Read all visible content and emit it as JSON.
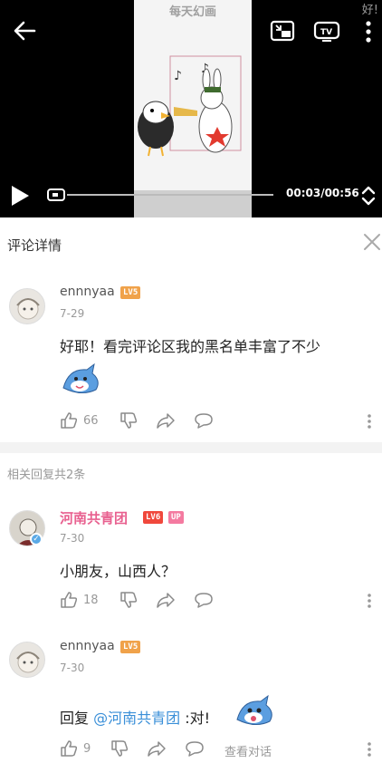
{
  "player": {
    "caption": "每天幻画",
    "corner_glyph": "好!",
    "time": "00:03/00:56",
    "progress": 0.05,
    "icons": [
      "back-arrow-icon",
      "picture-in-picture-icon",
      "cast-tv-icon",
      "more-vertical-icon",
      "play-icon",
      "fullscreen-toggle-icon"
    ]
  },
  "panel": {
    "title": "评论详情"
  },
  "main_comment": {
    "user": "ennnyaa",
    "level": "LV5",
    "date": "7-29",
    "text": "好耶！看完评论区我的黑名单丰富了不少",
    "likes": "66"
  },
  "related": {
    "label": "相关回复共2条"
  },
  "replies": [
    {
      "user": "河南共青团",
      "level": "LV6",
      "badge": "UP",
      "date": "7-30",
      "text": "小朋友，山西人？",
      "likes": "18"
    },
    {
      "user": "ennnyaa",
      "level": "LV5",
      "date": "7-30",
      "reply_prefix": "回复 ",
      "mention": "@河南共青团",
      "text_suffix": " :对!",
      "likes": "9",
      "view_thread": "查看对话"
    }
  ],
  "colors": {
    "accent_pink": "#e8608f",
    "mention_blue": "#3a8fd8",
    "lv5": "#f0a24a",
    "lv6": "#f0483c"
  }
}
